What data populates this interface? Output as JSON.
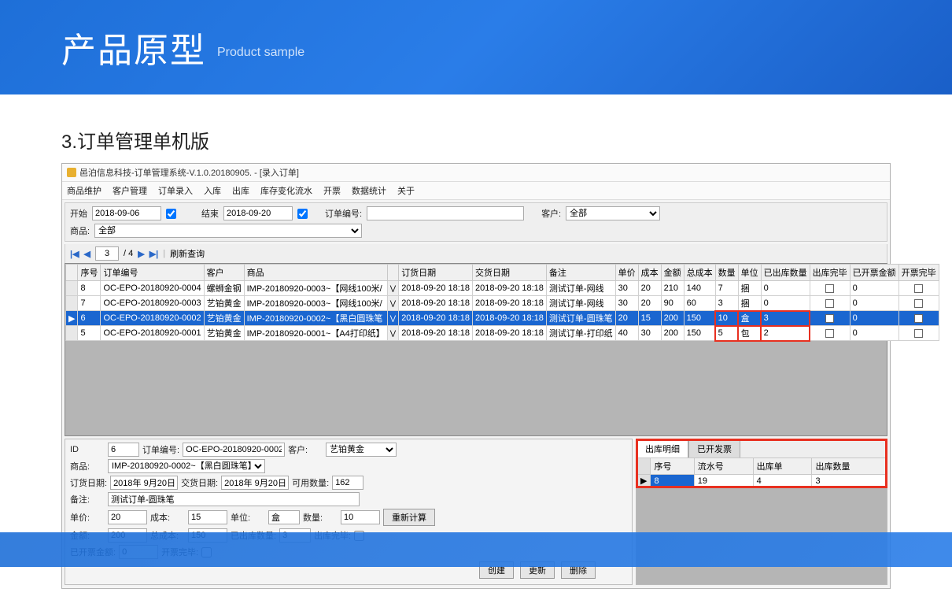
{
  "header": {
    "cn": "产品原型",
    "en": "Product sample"
  },
  "section_title": "3.订单管理单机版",
  "window_title": "邑泊信息科技-订单管理系统-V.1.0.20180905. - [录入订单]",
  "menus": [
    "商品维护",
    "客户管理",
    "订单录入",
    "入库",
    "出库",
    "库存变化流水",
    "开票",
    "数据统计",
    "关于"
  ],
  "filter": {
    "start_lbl": "开始",
    "start_val": "2018-09-06",
    "end_lbl": "结束",
    "end_val": "2018-09-20",
    "orderno_lbl": "订单编号:",
    "orderno_val": "",
    "customer_lbl": "客户:",
    "customer_val": "全部",
    "product_lbl": "商品:",
    "product_val": "全部"
  },
  "pager": {
    "page": "3",
    "total": "/ 4",
    "refresh": "刷新查询"
  },
  "grid_headers": [
    "序号",
    "订单编号",
    "客户",
    "商品",
    "",
    "订货日期",
    "交货日期",
    "备注",
    "单价",
    "成本",
    "金额",
    "总成本",
    "数量",
    "单位",
    "已出库数量",
    "出库完毕",
    "已开票金额",
    "开票完毕"
  ],
  "grid_rows": [
    {
      "sel": false,
      "c": [
        "8",
        "OC-EPO-20180920-0004",
        "螺蛳金钢",
        "IMP-20180920-0003~【网线100米/",
        "",
        " 2018-09-20 18:18",
        "2018-09-20 18:18",
        "测试订单-网线",
        "30",
        "20",
        "210",
        "140",
        "7",
        "捆",
        "0",
        "",
        "0",
        ""
      ]
    },
    {
      "sel": false,
      "c": [
        "7",
        "OC-EPO-20180920-0003",
        "艺铂黄金",
        "IMP-20180920-0003~【网线100米/",
        "",
        " 2018-09-20 18:18",
        "2018-09-20 18:18",
        "测试订单-网线",
        "30",
        "20",
        "90",
        "60",
        "3",
        "捆",
        "0",
        "",
        "0",
        ""
      ]
    },
    {
      "sel": true,
      "c": [
        "6",
        "OC-EPO-20180920-0002",
        "艺铂黄金",
        "IMP-20180920-0002~【黑白圆珠笔",
        "",
        " 2018-09-20 18:18",
        "2018-09-20 18:18",
        "测试订单-圆珠笔",
        "20",
        "15",
        "200",
        "150",
        "10",
        "盒",
        "3",
        "",
        "0",
        ""
      ]
    },
    {
      "sel": false,
      "c": [
        "5",
        "OC-EPO-20180920-0001",
        "艺铂黄金",
        "IMP-20180920-0001~【A4打印纸】",
        "",
        " 2018-09-20 18:18",
        "2018-09-20 18:18",
        "测试订单-打印纸",
        "40",
        "30",
        "200",
        "150",
        "5",
        "包",
        "2",
        "",
        "0",
        ""
      ]
    }
  ],
  "form": {
    "id_lbl": "ID",
    "id_val": "6",
    "orderno_lbl": "订单编号:",
    "orderno_val": "OC-EPO-20180920-0002",
    "customer_lbl": "客户:",
    "customer_val": "艺铂黄金",
    "product_lbl": "商品:",
    "product_val": "IMP-20180920-0002~【黑白圆珠笔】",
    "orderdate_lbl": "订货日期:",
    "orderdate_val": "2018年 9月20日",
    "delivdate_lbl": "交货日期:",
    "delivdate_val": "2018年 9月20日",
    "avail_lbl": "可用数量:",
    "avail_val": "162",
    "remark_lbl": "备注:",
    "remark_val": "测试订单-圆珠笔",
    "price_lbl": "单价:",
    "price_val": "20",
    "cost_lbl": "成本:",
    "cost_val": "15",
    "unit_lbl": "单位:",
    "unit_val": "盒",
    "qty_lbl": "数量:",
    "qty_val": "10",
    "recalc_btn": "重新计算",
    "amount_lbl": "金额:",
    "amount_val": "200",
    "totalcost_lbl": "总成本:",
    "totalcost_val": "150",
    "shipped_lbl": "已出库数量:",
    "shipped_val": "3",
    "shipdone_lbl": "出库完毕:",
    "invoiced_lbl": "已开票金额:",
    "invoiced_val": "0",
    "invdone_lbl": "开票完毕:",
    "create_btn": "创建",
    "update_btn": "更新",
    "delete_btn": "删除"
  },
  "detail": {
    "tab1": "出库明细",
    "tab2": "已开发票",
    "headers": [
      "序号",
      "流水号",
      "出库单",
      "出库数量"
    ],
    "row": [
      "8",
      "19",
      "4",
      "3"
    ]
  }
}
